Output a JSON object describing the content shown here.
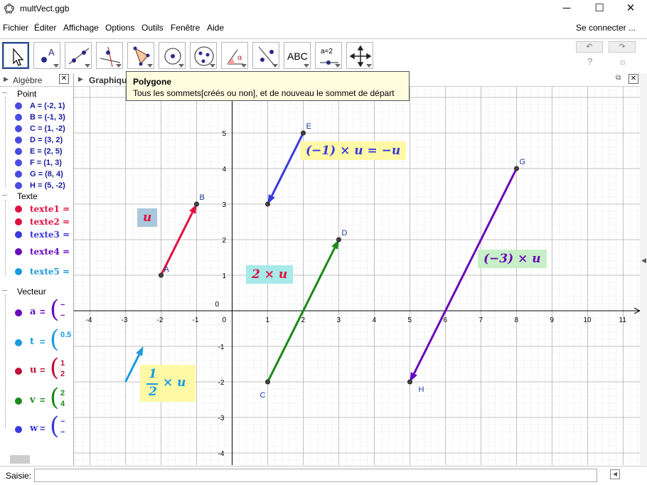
{
  "window": {
    "title": "multVect.ggb"
  },
  "menu": [
    "Fichier",
    "Éditer",
    "Affichage",
    "Options",
    "Outils",
    "Fenêtre",
    "Aide"
  ],
  "login": "Se connecter ...",
  "toolbar": {
    "text_tool": "ABC",
    "slider_tool": "a=2"
  },
  "tooltip": {
    "title": "Polygone",
    "description": "Tous les sommets[créés ou non], et de nouveau le sommet de départ"
  },
  "algebra": {
    "header": "Algèbre",
    "groups": {
      "point": "Point",
      "text": "Texte",
      "vector": "Vecteur"
    },
    "points": [
      "A = (-2, 1)",
      "B = (-1, 3)",
      "C = (1, -2)",
      "D = (3, 2)",
      "E = (2, 5)",
      "F = (1, 3)",
      "G = (8, 4)",
      "H = (5, -2)"
    ],
    "texts": [
      "texte1 =",
      "texte2 =",
      "texte3 =",
      "texte4 =",
      "texte5 ="
    ],
    "vectors": [
      {
        "name": "a",
        "c1": "−",
        "c2": "−"
      },
      {
        "name": "t",
        "c1": "0.5",
        "c2": ""
      },
      {
        "name": "u",
        "c1": "1",
        "c2": "2"
      },
      {
        "name": "v",
        "c1": "2",
        "c2": "4"
      },
      {
        "name": "w",
        "c1": "−",
        "c2": "−"
      }
    ]
  },
  "graphics": {
    "header": "Graphique",
    "x_ticks": [
      "-4",
      "-3",
      "-2",
      "-1",
      "0",
      "1",
      "2",
      "3",
      "4",
      "5",
      "6",
      "7",
      "8",
      "9",
      "10",
      "11"
    ],
    "y_ticks": [
      "5",
      "4",
      "3",
      "2",
      "1",
      "0",
      "-1",
      "-2",
      "-3",
      "-4"
    ],
    "point_labels": [
      "A",
      "B",
      "C",
      "D",
      "E",
      "G",
      "H"
    ],
    "labels": {
      "u": "u",
      "neg": "(−1) × u = −u",
      "two": "2 × u",
      "three": "(−3) × u",
      "half_num": "1",
      "half_den": "2",
      "half_rest": "× u"
    },
    "colors": {
      "red": "#e01040",
      "blue": "#3a3adc",
      "green": "#1a8a1a",
      "purple": "#6a0aba",
      "cyan": "#1a9ae0"
    }
  },
  "input": {
    "label": "Saisie:"
  }
}
